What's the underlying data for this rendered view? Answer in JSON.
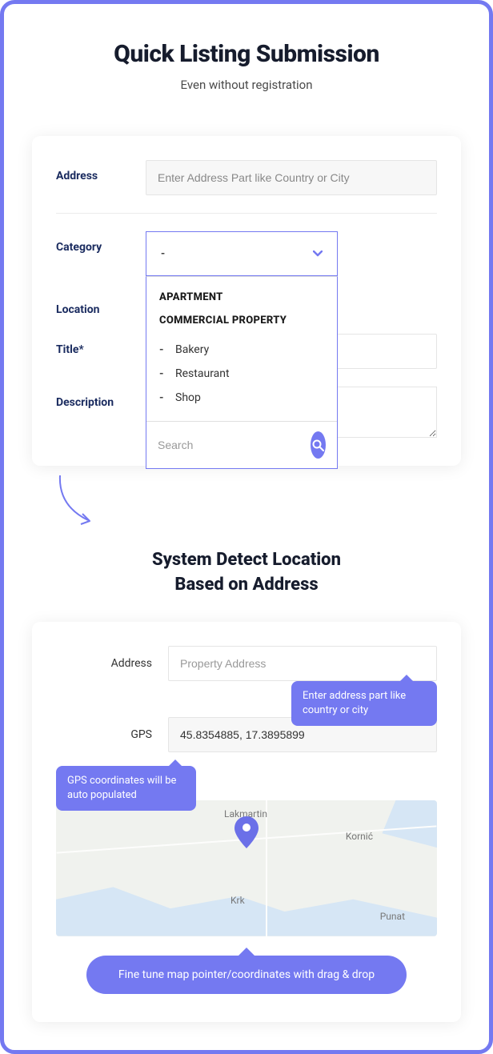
{
  "header": {
    "title": "Quick Listing Submission",
    "subtitle": "Even without registration"
  },
  "form1": {
    "address_label": "Address",
    "address_placeholder": "Enter Address Part like Country or City",
    "category_label": "Category",
    "category_value": "-",
    "location_label": "Location",
    "title_label": "Title*",
    "description_label": "Description",
    "dropdown": {
      "group1": "APARTMENT",
      "group2": "COMMERCIAL PROPERTY",
      "items": [
        "Bakery",
        "Restaurant",
        "Shop"
      ],
      "search_placeholder": "Search"
    }
  },
  "section2": {
    "title_line1": "System Detect Location",
    "title_line2": "Based on Address"
  },
  "form2": {
    "address_label": "Address",
    "address_placeholder": "Property Address",
    "gps_label": "GPS",
    "gps_value": "45.8354885, 17.3895899",
    "tooltip1": "Enter address part like country or city",
    "tooltip2": "GPS coordinates will be auto populated",
    "map": {
      "labels": [
        "Lakmartin",
        "Kornić",
        "Krk",
        "Punat"
      ],
      "pill": "Fine tune map pointer/coordinates with drag & drop"
    }
  }
}
